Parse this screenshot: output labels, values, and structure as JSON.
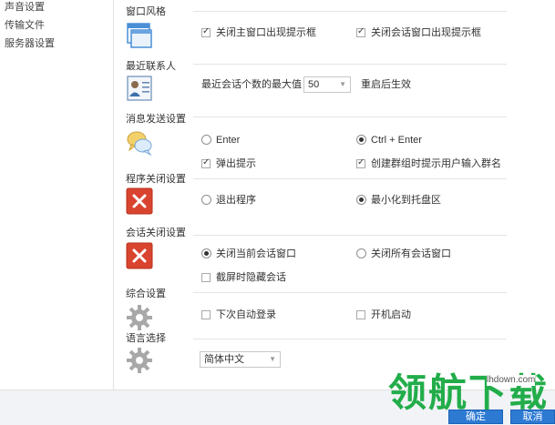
{
  "nav": {
    "items": [
      "声音设置",
      "传输文件",
      "服务器设置"
    ]
  },
  "sections": {
    "window_style": {
      "title": "窗口风格",
      "close_main_prompt": "关闭主窗口出现提示框",
      "close_chat_prompt": "关闭会话窗口出现提示框"
    },
    "recent_contacts": {
      "title": "最近联系人",
      "max_label": "最近会话个数的最大值",
      "max_value": "50",
      "restart_note": "重启后生效"
    },
    "message_send": {
      "title": "消息发送设置",
      "enter_option": "Enter",
      "ctrl_enter_option": "Ctrl + Enter",
      "popup_tip": "弹出提示",
      "group_name_tip": "创建群组时提示用户输入群名"
    },
    "program_close": {
      "title": "程序关闭设置",
      "exit_option": "退出程序",
      "minimize_option": "最小化到托盘区"
    },
    "chat_close": {
      "title": "会话关闭设置",
      "close_current": "关闭当前会话窗口",
      "close_all": "关闭所有会话窗口",
      "hide_on_screenshot": "截屏时隐藏会话"
    },
    "general": {
      "title": "综合设置",
      "auto_login": "下次自动登录",
      "auto_start": "开机启动"
    },
    "language": {
      "title": "语言选择",
      "selected": "简体中文"
    }
  },
  "footer": {
    "ok_label": "确定",
    "cancel_label": "取消"
  },
  "watermark": {
    "text": "领航下载",
    "url": "lhdown.com"
  },
  "colors": {
    "accent": "#2d7ad3",
    "close_icon": "#d9442f",
    "watermark": "#22ad4a"
  }
}
